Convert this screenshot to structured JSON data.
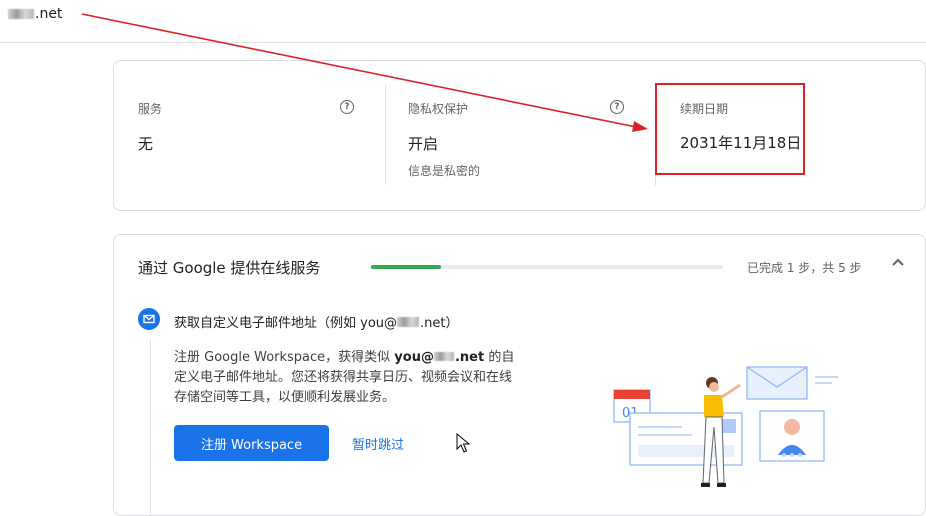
{
  "header": {
    "domain_suffix": ".net"
  },
  "summary": {
    "service": {
      "label": "服务",
      "value": "无"
    },
    "privacy": {
      "label": "隐私权保护",
      "value": "开启",
      "sub": "信息是私密的"
    },
    "renewal": {
      "label": "续期日期",
      "value": "2031年11月18日"
    }
  },
  "setup": {
    "title": "通过 Google 提供在线服务",
    "progress_text": "已完成 1 步，共 5 步",
    "progress_fraction": 0.2,
    "step": {
      "title_prefix": "获取自定义电子邮件地址（例如 you@",
      "title_suffix": ".net）",
      "desc_1": "注册 Google Workspace，获得类似 ",
      "desc_bold_prefix": "you@",
      "desc_bold_suffix": ".net",
      "desc_2": " 的自定义电子邮件地址。您还将获得共享日历、视频会议和在线存储空间等工具，以便顺利发展业务。",
      "primary_button": "注册 Workspace",
      "skip_link": "暂时跳过"
    },
    "illustration": {
      "calendar_number": "01"
    }
  },
  "colors": {
    "accent": "#1a73e8",
    "progress": "#34a853",
    "annotation": "#d9232a"
  }
}
